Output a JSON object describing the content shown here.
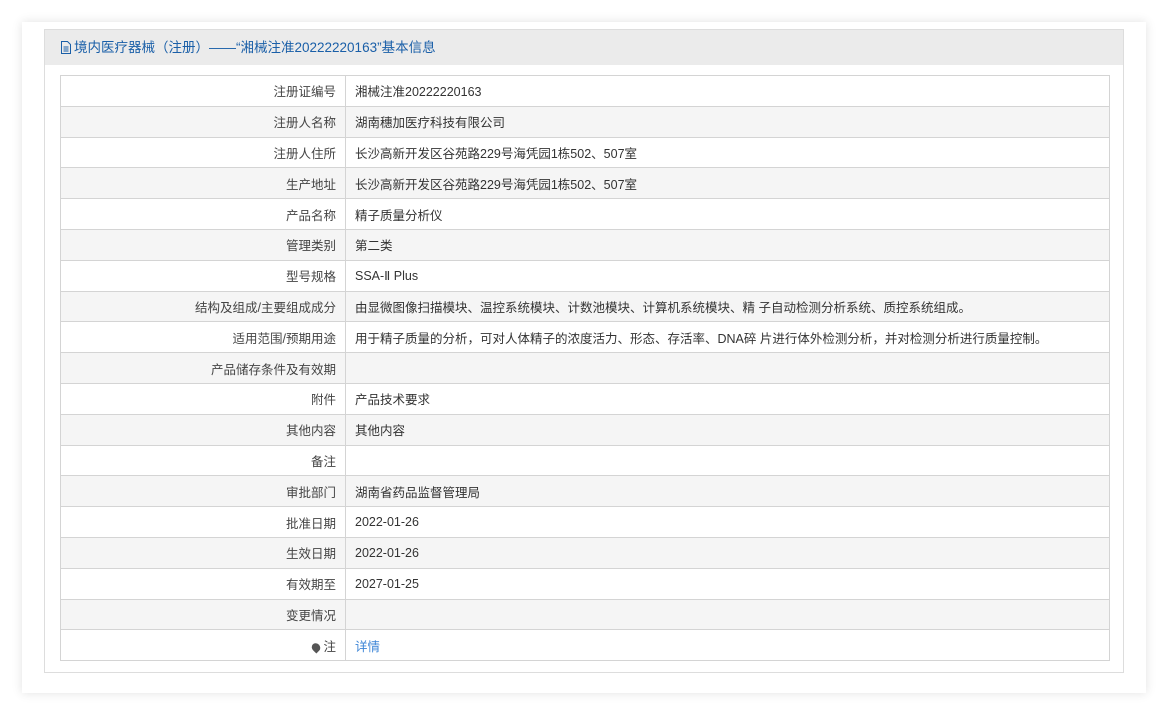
{
  "header": {
    "title": "境内医疗器械（注册）——“湘械注准20222220163”基本信息"
  },
  "rows": [
    {
      "label": "注册证编号",
      "value": "湘械注准20222220163"
    },
    {
      "label": "注册人名称",
      "value": "湖南穗加医疗科技有限公司"
    },
    {
      "label": "注册人住所",
      "value": "长沙高新开发区谷苑路229号海凭园1栋502、507室"
    },
    {
      "label": "生产地址",
      "value": "长沙高新开发区谷苑路229号海凭园1栋502、507室"
    },
    {
      "label": "产品名称",
      "value": "精子质量分析仪"
    },
    {
      "label": "管理类别",
      "value": "第二类"
    },
    {
      "label": "型号规格",
      "value": "SSA-Ⅱ Plus"
    },
    {
      "label": "结构及组成/主要组成成分",
      "value": "由显微图像扫描模块、温控系统模块、计数池模块、计算机系统模块、精 子自动检测分析系统、质控系统组成。"
    },
    {
      "label": "适用范围/预期用途",
      "value": "用于精子质量的分析，可对人体精子的浓度活力、形态、存活率、DNA碎 片进行体外检测分析，并对检测分析进行质量控制。"
    },
    {
      "label": "产品储存条件及有效期",
      "value": ""
    },
    {
      "label": "附件",
      "value": "产品技术要求"
    },
    {
      "label": "其他内容",
      "value": "其他内容"
    },
    {
      "label": "备注",
      "value": ""
    },
    {
      "label": "审批部门",
      "value": "湖南省药品监督管理局"
    },
    {
      "label": "批准日期",
      "value": "2022-01-26"
    },
    {
      "label": "生效日期",
      "value": "2022-01-26"
    },
    {
      "label": "有效期至",
      "value": "2027-01-25"
    },
    {
      "label": "变更情况",
      "value": ""
    }
  ],
  "note": {
    "label": "注",
    "link": "详情"
  }
}
